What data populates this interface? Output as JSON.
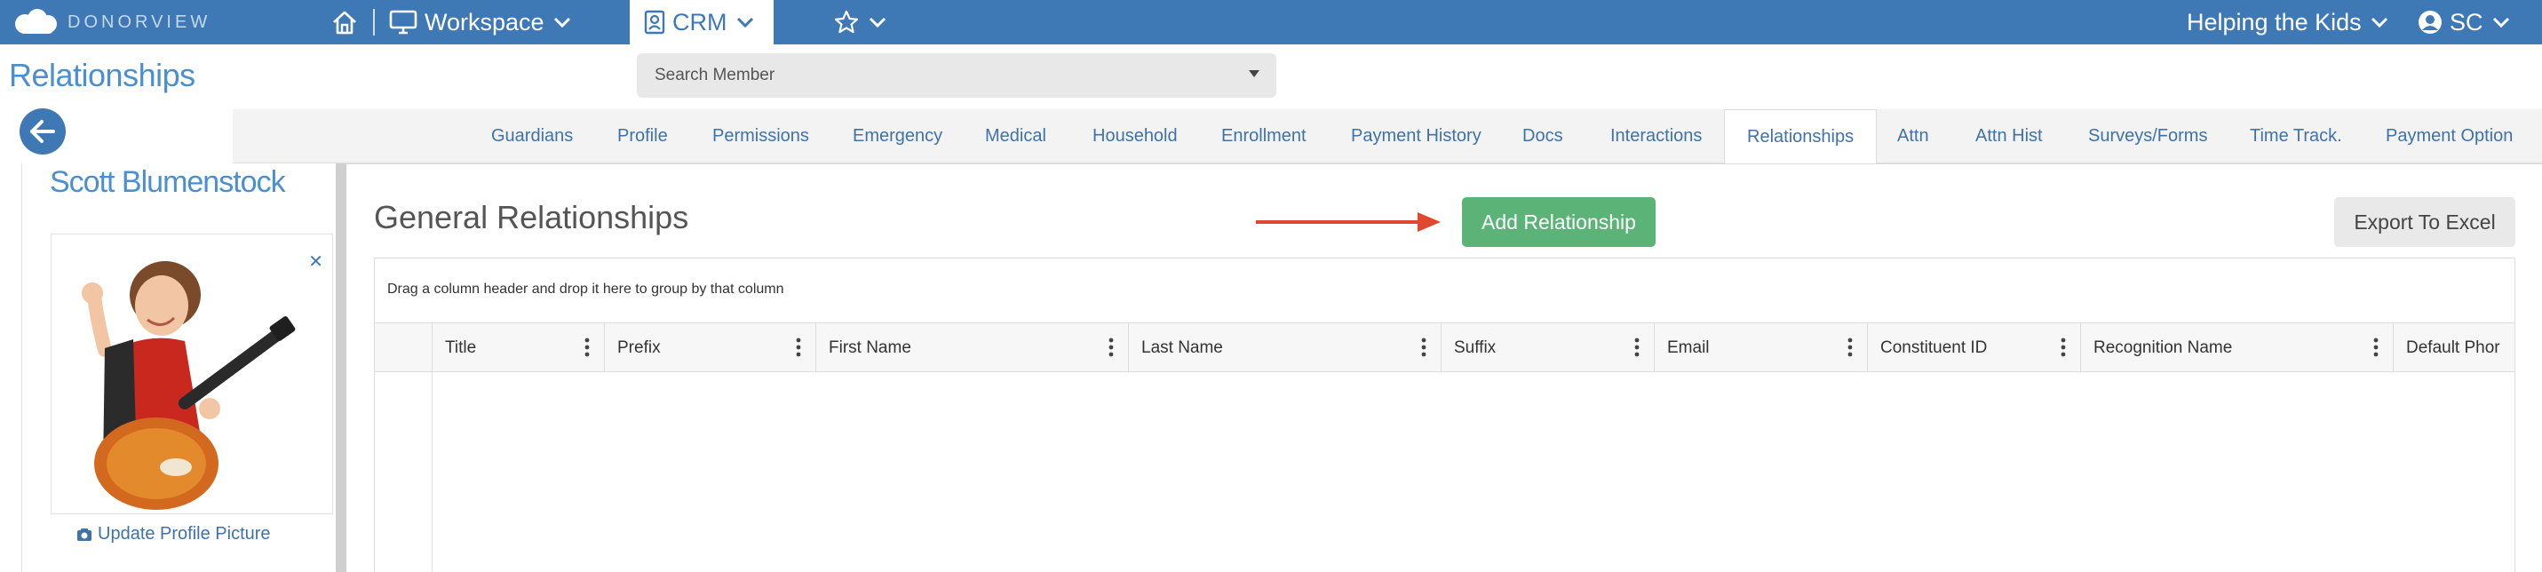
{
  "app": {
    "logo_text": "DONORVIEW"
  },
  "topnav": {
    "workspace_label": "Workspace",
    "crm_label": "CRM",
    "org_label": "Helping the Kids",
    "user_initials": "SC"
  },
  "page": {
    "title": "Relationships"
  },
  "search": {
    "placeholder": "Search Member"
  },
  "tabs": [
    {
      "label": "Guardians"
    },
    {
      "label": "Profile"
    },
    {
      "label": "Permissions"
    },
    {
      "label": "Emergency"
    },
    {
      "label": "Medical"
    },
    {
      "label": "Household"
    },
    {
      "label": "Enrollment"
    },
    {
      "label": "Payment History"
    },
    {
      "label": "Docs"
    },
    {
      "label": "Interactions"
    },
    {
      "label": "Relationships",
      "active": true
    },
    {
      "label": "Attn"
    },
    {
      "label": "Attn Hist"
    },
    {
      "label": "Surveys/Forms"
    },
    {
      "label": "Time Track."
    },
    {
      "label": "Payment Option"
    }
  ],
  "profile": {
    "name": "Scott Blumenstock",
    "update_picture_label": "Update Profile Picture"
  },
  "section": {
    "title": "General Relationships",
    "add_button": "Add Relationship",
    "export_button": "Export To Excel"
  },
  "grid": {
    "group_hint": "Drag a column header and drop it here to group by that column",
    "columns": [
      {
        "label": "Title"
      },
      {
        "label": "Prefix"
      },
      {
        "label": "First Name"
      },
      {
        "label": "Last Name"
      },
      {
        "label": "Suffix"
      },
      {
        "label": "Email"
      },
      {
        "label": "Constituent ID"
      },
      {
        "label": "Recognition Name"
      },
      {
        "label": "Default Phor"
      }
    ]
  },
  "colors": {
    "nav_blue": "#3f79b5",
    "link_blue": "#4a8fd0",
    "add_green": "#5cb377",
    "arrow_red": "#e0482f"
  },
  "icons": [
    "home-icon",
    "monitor-icon",
    "contact-card-icon",
    "star-icon",
    "chevron-down-icon",
    "user-circle-icon",
    "back-arrow-icon",
    "close-icon",
    "camera-icon",
    "kebab-menu-icon",
    "red-arrow"
  ]
}
